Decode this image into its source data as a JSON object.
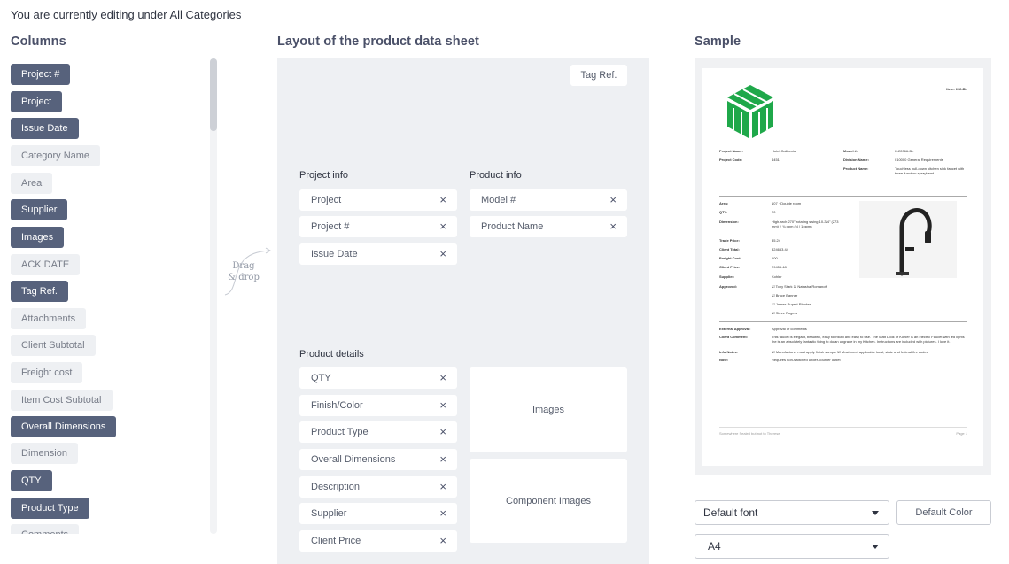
{
  "header": {
    "editing_text": "You are currently editing under All Categories"
  },
  "columns": {
    "title": "Columns",
    "items": [
      {
        "label": "Project #",
        "active": true
      },
      {
        "label": "Project",
        "active": true
      },
      {
        "label": "Issue Date",
        "active": true
      },
      {
        "label": "Category Name",
        "active": false
      },
      {
        "label": "Area",
        "active": false
      },
      {
        "label": "Supplier",
        "active": true
      },
      {
        "label": "Images",
        "active": true
      },
      {
        "label": "ACK DATE",
        "active": false
      },
      {
        "label": "Tag Ref.",
        "active": true
      },
      {
        "label": "Attachments",
        "active": false
      },
      {
        "label": "Client Subtotal",
        "active": false
      },
      {
        "label": "Freight cost",
        "active": false
      },
      {
        "label": "Item Cost Subtotal",
        "active": false
      },
      {
        "label": "Overall Dimensions",
        "active": true
      },
      {
        "label": "Dimension",
        "active": false
      },
      {
        "label": "QTY",
        "active": true
      },
      {
        "label": "Product Type",
        "active": true
      },
      {
        "label": "Comments",
        "active": false
      }
    ]
  },
  "drag_hint": "Drag & drop",
  "layout": {
    "title": "Layout of the product data sheet",
    "tag_ref": "Tag Ref.",
    "project_info": {
      "label": "Project info",
      "fields": [
        "Project",
        "Project #",
        "Issue Date"
      ]
    },
    "product_info": {
      "label": "Product info",
      "fields": [
        "Model #",
        "Product Name"
      ]
    },
    "product_details": {
      "label": "Product details",
      "fields": [
        "QTY",
        "Finish/Color",
        "Product Type",
        "Overall Dimensions",
        "Description",
        "Supplier",
        "Client Price"
      ],
      "images_label": "Images",
      "component_images_label": "Component Images"
    },
    "remove_icon": "×"
  },
  "sample": {
    "title": "Sample",
    "item_ref": "Item: K-2-BL",
    "project_name_label": "Project Name:",
    "project_name": "Hotel California",
    "project_code_label": "Project Code:",
    "project_code": "4451",
    "model_label": "Model #:",
    "model": "K-22066-BL",
    "division_label": "Division Name:",
    "division": "010000 General Requirements",
    "product_name_label": "Product Name:",
    "product_name": "Touchless pull-down kitchen sink faucet with three-function sprayhead",
    "area_label": "Area:",
    "area": "107 · Double room",
    "qty_label": "QTY:",
    "qty": "20",
    "dimension_label": "Dimension:",
    "dimension": "High-arch 270° rotating swing 10-3/4\" (273 mm) ↑ ¾ gpm (N / 1 gpm)",
    "trade_price_label": "Trade Price:",
    "trade_price": "85.24",
    "client_total_label": "Client Total:",
    "client_total": "824653.44",
    "freight_cost_label": "Freight Cost:",
    "freight_cost": "100",
    "client_price_label": "Client Price:",
    "client_price": "29455.48",
    "supplier_label": "Supplier:",
    "supplier": "Kohler",
    "approved_label": "Approved:",
    "approvers": [
      "Tony Stark",
      "Natasha Romanoff",
      "Bruce Banner",
      "James Rupert Rhodes",
      "Steve Rogers"
    ],
    "external_approval_label": "External Approval:",
    "external_approval": "Approval of comments",
    "client_comment_label": "Client Comment:",
    "client_comment": "This faucet is elegant, beautiful, easy to install and easy to use. The Matt Look of Kohler is an electric Faucet with led lights the is an absolutely fantastic thing to do an upgrade in my Kitchen. Instructions are included with pictures. I love it.",
    "info_notes_label": "Info Notes:",
    "info_notes": [
      "Manufacturer must apply finish sample",
      "Must meet applicable local, state and federal fire codes"
    ],
    "note_label": "Note:",
    "note": "Requires non-switched under-counter outlet",
    "footer_left": "Somewhere Sealed but not to Therese",
    "footer_right": "Page 1"
  },
  "controls": {
    "font_select": "Default font",
    "color_button": "Default Color",
    "page_select": "A4"
  },
  "colors": {
    "pill_active": "#57627c",
    "pill_inactive": "#eef0f3",
    "logo_green": "#1fa84a"
  }
}
